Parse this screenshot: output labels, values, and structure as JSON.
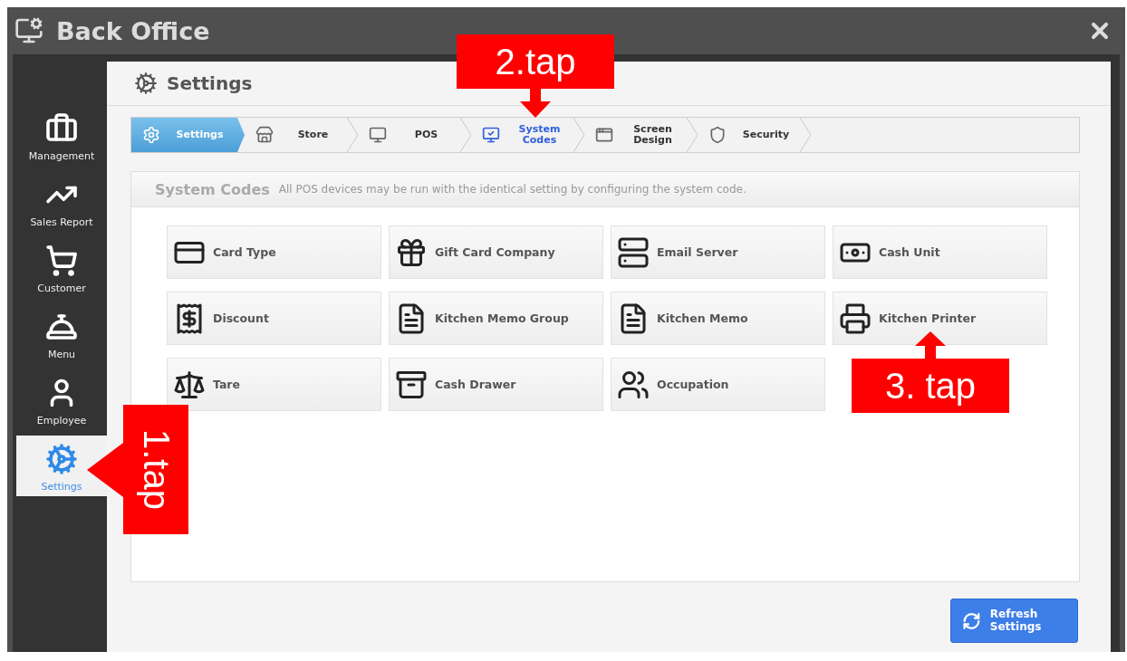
{
  "window": {
    "title": "Back Office"
  },
  "sidebar": {
    "items": [
      {
        "label": "Management",
        "selected": false
      },
      {
        "label": "Sales Report",
        "selected": false
      },
      {
        "label": "Customer",
        "selected": false
      },
      {
        "label": "Menu",
        "selected": false
      },
      {
        "label": "Employee",
        "selected": false
      },
      {
        "label": "Settings",
        "selected": true
      }
    ]
  },
  "page": {
    "title": "Settings"
  },
  "steps": [
    {
      "label": "Settings",
      "filled": true,
      "selected": false
    },
    {
      "label": "Store",
      "filled": false,
      "selected": false
    },
    {
      "label": "POS",
      "filled": false,
      "selected": false
    },
    {
      "label": "System Codes",
      "filled": false,
      "selected": true
    },
    {
      "label": "Screen Design",
      "filled": false,
      "selected": false
    },
    {
      "label": "Security",
      "filled": false,
      "selected": false
    }
  ],
  "panel": {
    "title": "System Codes",
    "description": "All POS devices may be run with the identical setting by configuring the system code.",
    "tiles": [
      "Card Type",
      "Gift Card Company",
      "Email Server",
      "Cash Unit",
      "Discount",
      "Kitchen Memo Group",
      "Kitchen Memo",
      "Kitchen Printer",
      "Tare",
      "Cash Drawer",
      "Occupation"
    ]
  },
  "refresh_button": "Refresh Settings",
  "annotations": [
    {
      "label": "2.tap",
      "kind": "down"
    },
    {
      "label": "3. tap",
      "kind": "up"
    },
    {
      "label": "1.tap",
      "kind": "left"
    }
  ]
}
